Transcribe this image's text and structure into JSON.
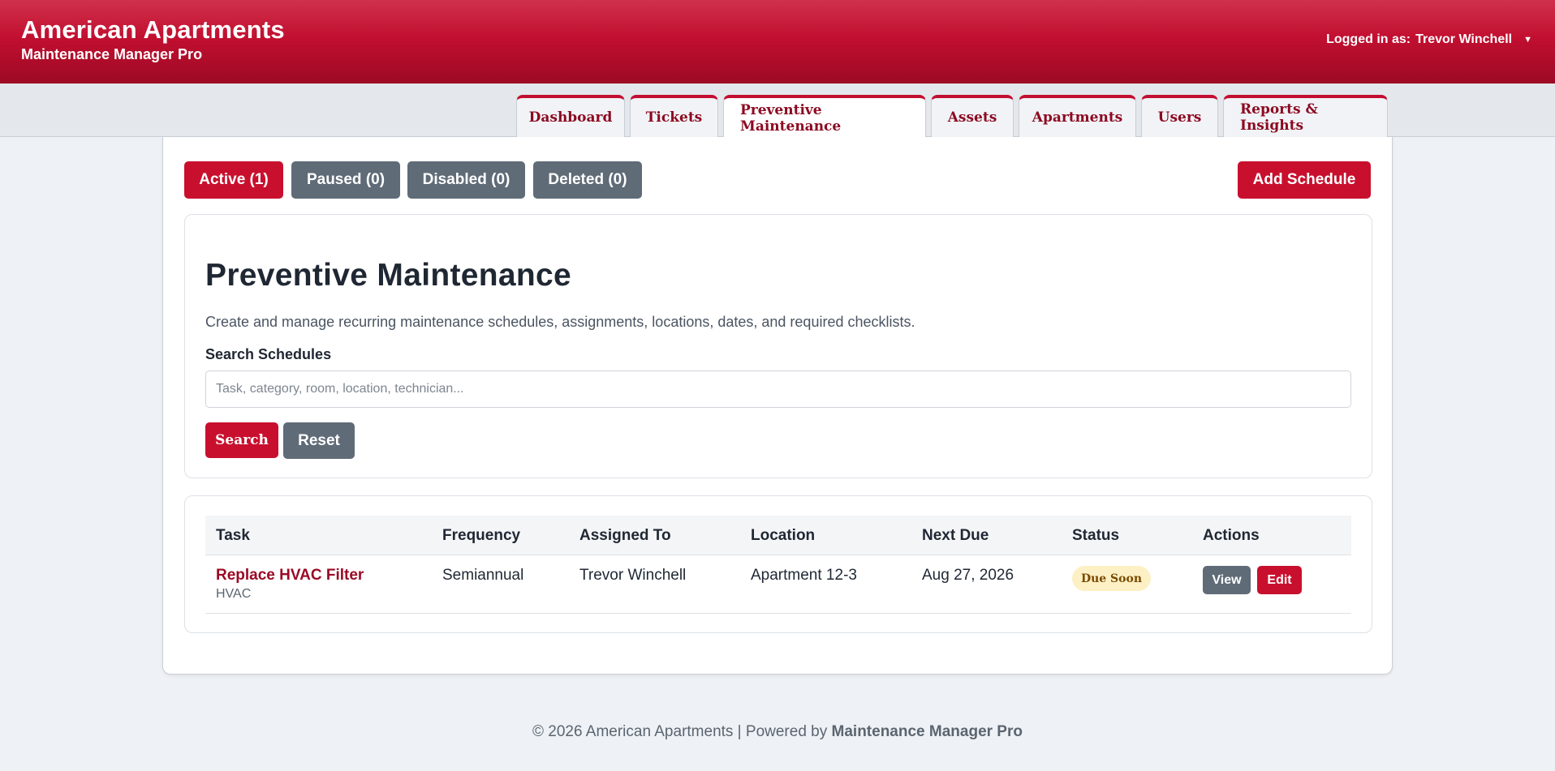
{
  "header": {
    "title": "American Apartments",
    "subtitle": "Maintenance Manager Pro",
    "logged_in_label": "Logged in as:",
    "user_name": "Trevor Winchell",
    "caret": "▼"
  },
  "tabs": [
    {
      "label": "Dashboard",
      "active": false
    },
    {
      "label": "Tickets",
      "active": false
    },
    {
      "label": "Preventive Maintenance",
      "active": true
    },
    {
      "label": "Assets",
      "active": false
    },
    {
      "label": "Apartments",
      "active": false
    },
    {
      "label": "Users",
      "active": false
    },
    {
      "label": "Reports & Insights",
      "active": false
    }
  ],
  "filters": {
    "active": "Active (1)",
    "paused": "Paused (0)",
    "disabled": "Disabled (0)",
    "deleted": "Deleted (0)",
    "add_schedule": "Add Schedule"
  },
  "search_card": {
    "title": "Preventive Maintenance",
    "description": "Create and manage recurring maintenance schedules, assignments, locations, dates, and required checklists.",
    "label": "Search Schedules",
    "placeholder": "Task, category, room, location, technician...",
    "value": "",
    "search_button": "Search",
    "reset_button": "Reset"
  },
  "table": {
    "columns": [
      "Task",
      "Frequency",
      "Assigned To",
      "Location",
      "Next Due",
      "Status",
      "Actions"
    ],
    "rows": [
      {
        "task": "Replace HVAC Filter",
        "category": "HVAC",
        "frequency": "Semiannual",
        "assigned_to": "Trevor Winchell",
        "location": "Apartment 12-3",
        "next_due": "Aug 27, 2026",
        "status": "Due Soon",
        "view": "View",
        "edit": "Edit"
      }
    ]
  },
  "footer": {
    "text": "© 2026 American Apartments | Powered by",
    "brand": "Maintenance Manager Pro"
  },
  "colors": {
    "brand_red": "#c8102e",
    "dark_red": "#9b0a25",
    "gray_button": "#5f6b77",
    "badge_bg": "#fdf0c4"
  }
}
